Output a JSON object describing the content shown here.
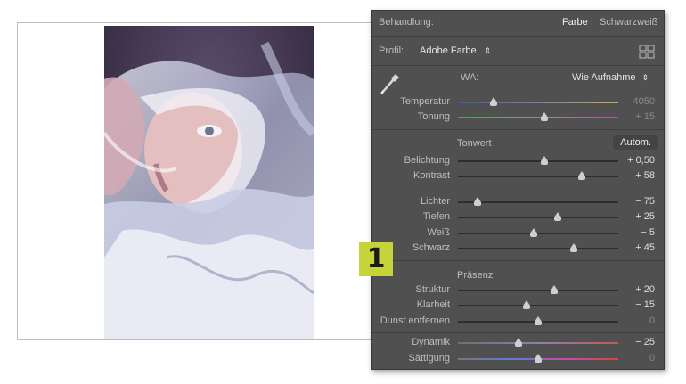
{
  "badge": {
    "number": "1"
  },
  "treatment": {
    "label": "Behandlung:",
    "color_option": "Farbe",
    "bw_option": "Schwarzweiß"
  },
  "profile": {
    "label": "Profil:",
    "value": "Adobe Farbe",
    "grid_icon": "grid-icon"
  },
  "wb": {
    "label": "WA:",
    "value": "Wie Aufnahme",
    "eyedropper_icon": "eyedropper-icon"
  },
  "sliders_wb": [
    {
      "label": "Temperatur",
      "value": "4050",
      "fraction": 0.22,
      "dim": true,
      "track": "temp"
    },
    {
      "label": "Tonung",
      "value": "+ 15",
      "fraction": 0.54,
      "dim": true,
      "track": "tint"
    }
  ],
  "tone": {
    "heading": "Tonwert",
    "auto_label": "Autom."
  },
  "sliders_tone": [
    {
      "label": "Belichtung",
      "value": "+ 0,50",
      "fraction": 0.54
    },
    {
      "label": "Kontrast",
      "value": "+ 58",
      "fraction": 0.77
    }
  ],
  "sliders_tone2": [
    {
      "label": "Lichter",
      "value": "− 75",
      "fraction": 0.12
    },
    {
      "label": "Tiefen",
      "value": "+ 25",
      "fraction": 0.62
    },
    {
      "label": "Weiß",
      "value": "− 5",
      "fraction": 0.47
    },
    {
      "label": "Schwarz",
      "value": "+ 45",
      "fraction": 0.72
    }
  ],
  "presence": {
    "heading": "Präsenz"
  },
  "sliders_presence": [
    {
      "label": "Struktur",
      "value": "+ 20",
      "fraction": 0.6
    },
    {
      "label": "Klarheit",
      "value": "− 15",
      "fraction": 0.43
    },
    {
      "label": "Dunst entfernen",
      "value": "0",
      "fraction": 0.5,
      "dim": true
    }
  ],
  "sliders_color": [
    {
      "label": "Dynamik",
      "value": "− 25",
      "fraction": 0.38,
      "track": "vib"
    },
    {
      "label": "Sättigung",
      "value": "0",
      "fraction": 0.5,
      "dim": true,
      "track": "sat"
    }
  ]
}
